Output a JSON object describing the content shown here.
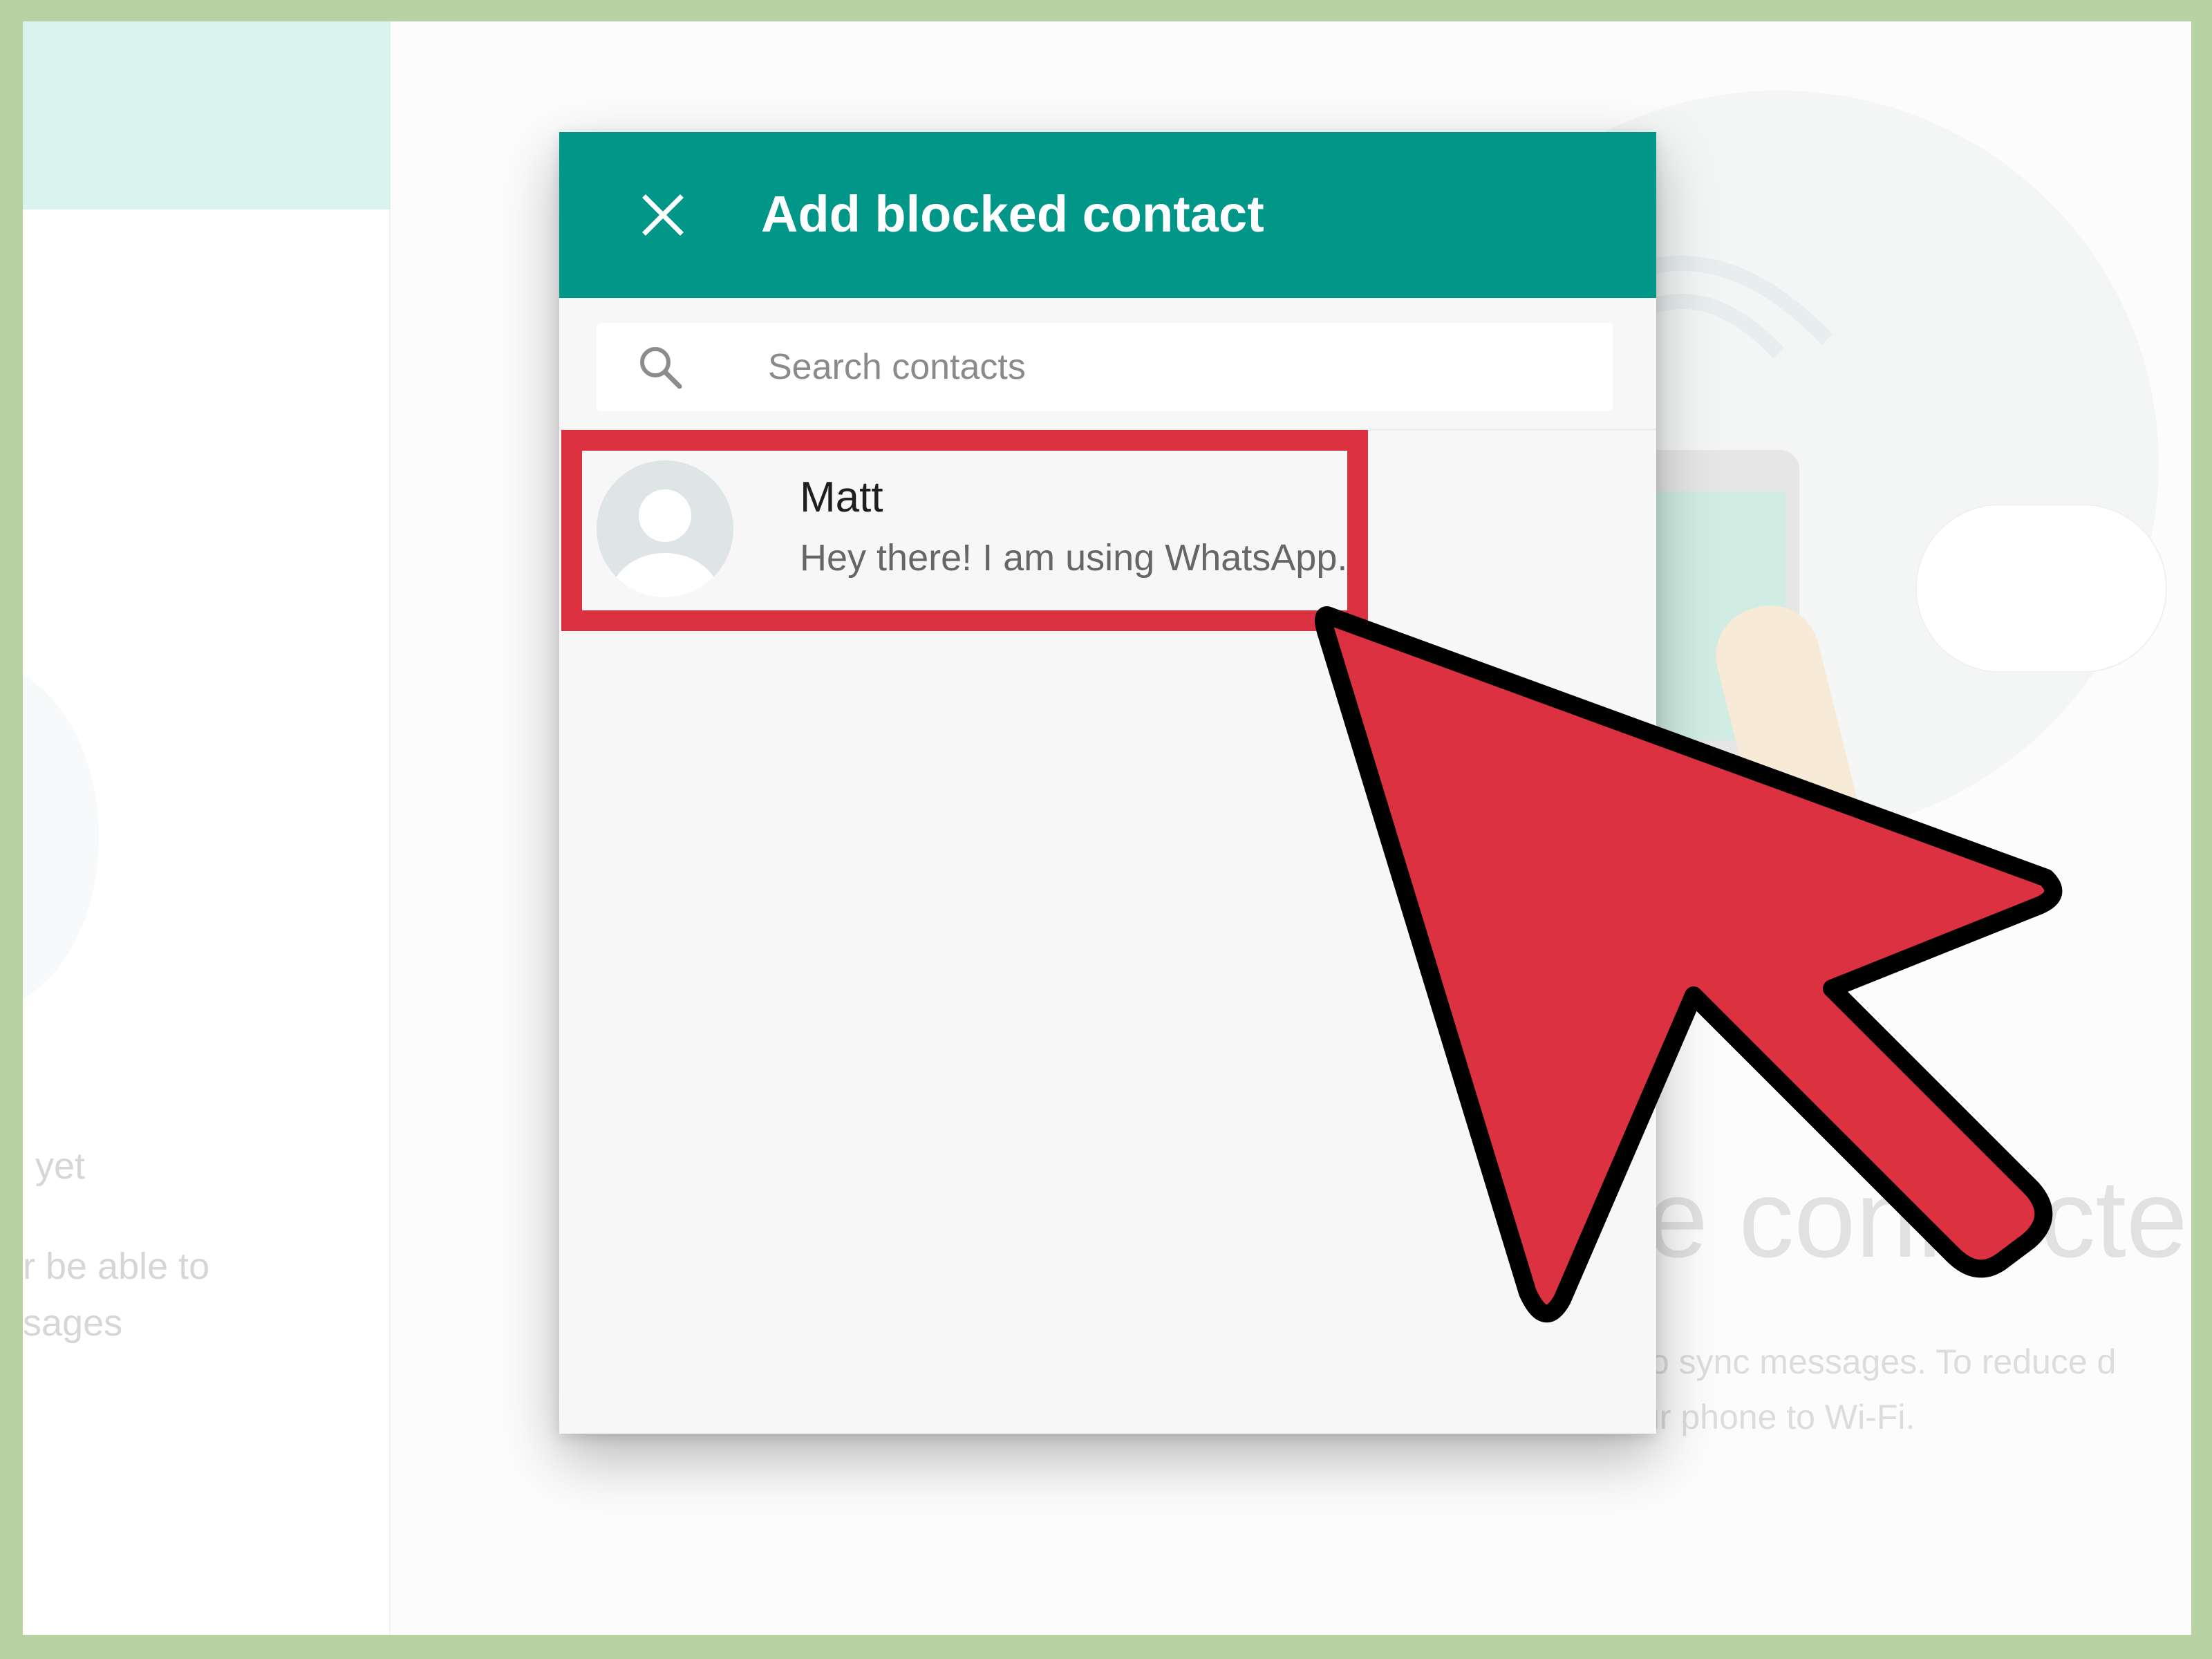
{
  "modal": {
    "title": "Add blocked contact",
    "search_placeholder": "Search contacts"
  },
  "contacts": [
    {
      "name": "Matt",
      "status": "Hey there! I am using WhatsApp."
    }
  ],
  "background": {
    "left_line1": "yet",
    "left_line2": "r be able to",
    "left_line3": "sages",
    "right_title": "ne connecte",
    "right_line1": "to sync messages. To reduce d",
    "right_line2": "ur phone to Wi-Fi."
  },
  "colors": {
    "header": "#009688",
    "highlight": "#dc3140",
    "frame": "#b8d2a4"
  },
  "icons": {
    "close": "close-icon",
    "search": "search-icon",
    "avatar": "default-avatar-icon",
    "cursor": "arrow-cursor-icon"
  }
}
